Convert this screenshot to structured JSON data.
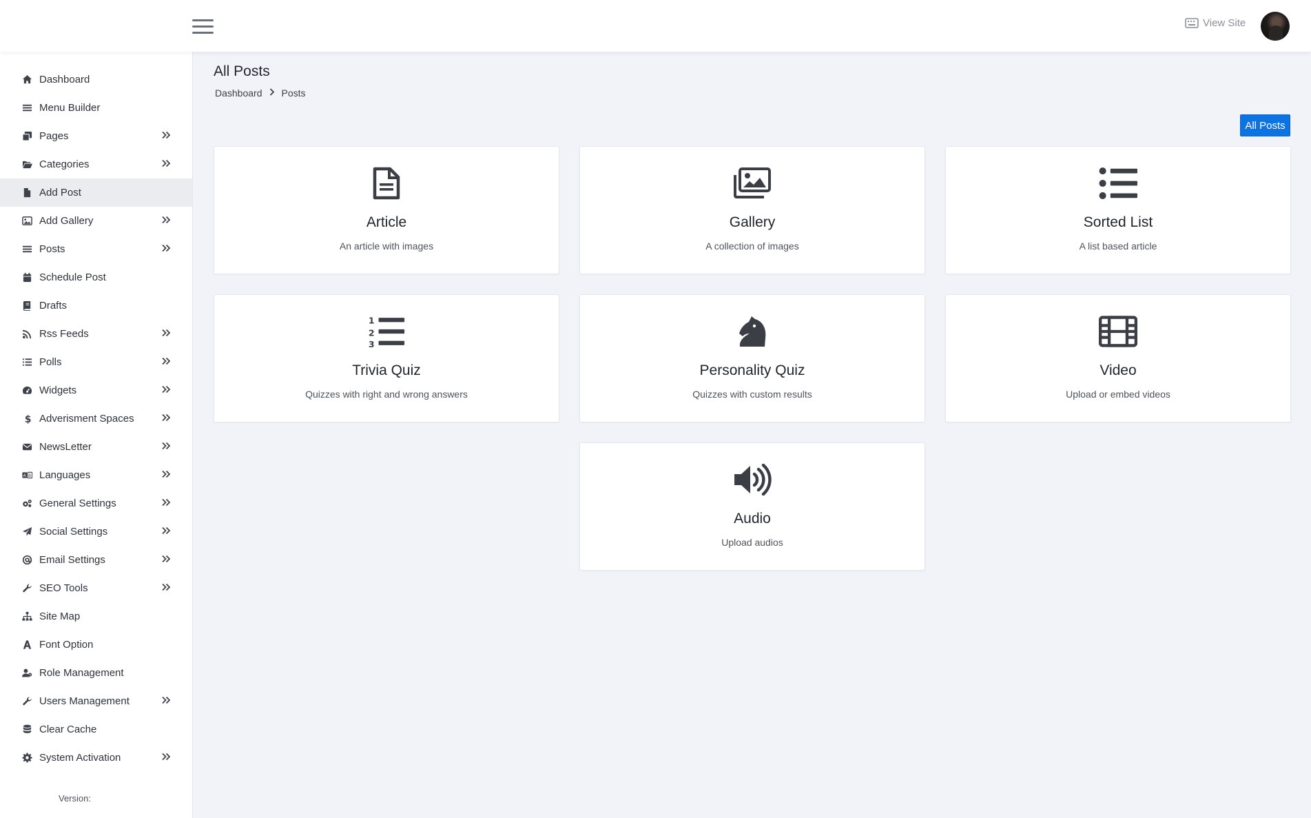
{
  "topbar": {
    "view_site_label": "View Site"
  },
  "sidebar": {
    "items": [
      {
        "label": "Dashboard",
        "icon": "home-icon",
        "chevron": false
      },
      {
        "label": "Menu Builder",
        "icon": "bars-icon",
        "chevron": false
      },
      {
        "label": "Pages",
        "icon": "copy-icon",
        "chevron": true
      },
      {
        "label": "Categories",
        "icon": "folder-open-icon",
        "chevron": true
      },
      {
        "label": "Add Post",
        "icon": "file-icon",
        "chevron": false,
        "active": true
      },
      {
        "label": "Add Gallery",
        "icon": "image-icon",
        "chevron": true
      },
      {
        "label": "Posts",
        "icon": "bars-icon",
        "chevron": true
      },
      {
        "label": "Schedule Post",
        "icon": "calendar-icon",
        "chevron": false
      },
      {
        "label": "Drafts",
        "icon": "book-icon",
        "chevron": false
      },
      {
        "label": "Rss Feeds",
        "icon": "rss-icon",
        "chevron": true
      },
      {
        "label": "Polls",
        "icon": "list-icon",
        "chevron": true
      },
      {
        "label": "Widgets",
        "icon": "dashboard-icon",
        "chevron": true
      },
      {
        "label": "Adverisment Spaces",
        "icon": "dollar-icon",
        "chevron": true
      },
      {
        "label": "NewsLetter",
        "icon": "envelope-icon",
        "chevron": true
      },
      {
        "label": "Languages",
        "icon": "language-icon",
        "chevron": true
      },
      {
        "label": "General Settings",
        "icon": "cogs-icon",
        "chevron": true
      },
      {
        "label": "Social Settings",
        "icon": "paper-plane-icon",
        "chevron": true
      },
      {
        "label": "Email Settings",
        "icon": "at-icon",
        "chevron": true
      },
      {
        "label": "SEO Tools",
        "icon": "wrench-icon",
        "chevron": true
      },
      {
        "label": "Site Map",
        "icon": "sitemap-icon",
        "chevron": false
      },
      {
        "label": "Font Option",
        "icon": "font-icon",
        "chevron": false
      },
      {
        "label": "Role Management",
        "icon": "user-cog-icon",
        "chevron": false
      },
      {
        "label": "Users Management",
        "icon": "wrench-icon",
        "chevron": true
      },
      {
        "label": "Clear Cache",
        "icon": "database-icon",
        "chevron": false
      },
      {
        "label": "System Activation",
        "icon": "cog-icon",
        "chevron": true
      }
    ],
    "version_label": "Version:"
  },
  "main": {
    "title": "All Posts",
    "breadcrumb": [
      "Dashboard",
      "Posts"
    ],
    "all_posts_button": "All Posts",
    "cards": [
      {
        "title": "Article",
        "desc": "An article with images",
        "icon": "file-alt-icon"
      },
      {
        "title": "Gallery",
        "desc": "A collection of images",
        "icon": "images-icon"
      },
      {
        "title": "Sorted List",
        "desc": "A list based article",
        "icon": "list-ul-icon"
      },
      {
        "title": "Trivia Quiz",
        "desc": "Quizzes with right and wrong answers",
        "icon": "list-ol-icon"
      },
      {
        "title": "Personality Quiz",
        "desc": "Quizzes with custom results",
        "icon": "chess-knight-icon"
      },
      {
        "title": "Video",
        "desc": "Upload or embed videos",
        "icon": "film-icon"
      },
      {
        "title": "Audio",
        "desc": "Upload audios",
        "icon": "volume-up-icon"
      }
    ]
  }
}
